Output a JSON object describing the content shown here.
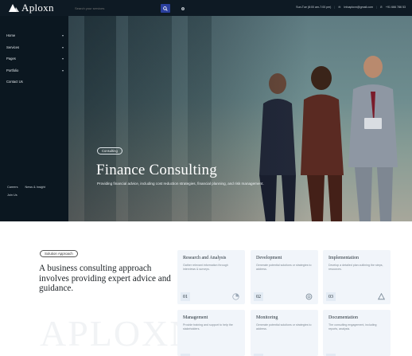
{
  "brand": {
    "name": "Aploxn"
  },
  "search": {
    "placeholder": "Search your services"
  },
  "contact": {
    "hours": "Sun-Tue (8:00 am-7:00 pm)",
    "email": "Infoaploxn@gmail.com",
    "phone": "+91 666 786 53"
  },
  "sidebar": {
    "items": [
      {
        "label": "Home",
        "has_children": true
      },
      {
        "label": "Services",
        "has_children": true
      },
      {
        "label": "Pages",
        "has_children": true
      },
      {
        "label": "Portfolio",
        "has_children": true
      },
      {
        "label": "Contact Us",
        "has_children": false
      }
    ],
    "bottom_links": [
      "Careers",
      "News & Insight",
      "Join Us"
    ]
  },
  "hero": {
    "tag": "Consulting",
    "title": "Finance Consulting",
    "description": "Providing financial advice, including cost reduction strategies, financial planning, and risk management."
  },
  "solution": {
    "tag": "Solution Approach",
    "lead": "A business consulting approach involves providing expert advice and guidance.",
    "watermark": "APLOXN"
  },
  "cards": [
    {
      "title": "Research and Analysis",
      "desc": "Gather relevant information through interviews & surveys.",
      "num": "01",
      "icon": "pie-chart-icon"
    },
    {
      "title": "Development",
      "desc": "Generate potential solutions or strategies to address.",
      "num": "02",
      "icon": "refresh-icon"
    },
    {
      "title": "Implementation",
      "desc": "Develop a detailed plan outlining the steps, resources.",
      "num": "03",
      "icon": "recycle-icon"
    },
    {
      "title": "Management",
      "desc": "Provide training and support to help the stakeholders.",
      "num": "",
      "icon": ""
    },
    {
      "title": "Monitoring",
      "desc": "Generate potential solutions or strategies to address.",
      "num": "",
      "icon": ""
    },
    {
      "title": "Documentation",
      "desc": "The consulting engagement, including reports, analysis.",
      "num": "",
      "icon": ""
    }
  ],
  "colors": {
    "topbar": "#0e1a24",
    "sidebar": "#0b1720",
    "accent": "#2a3f9e",
    "card": "#f1f5fa"
  }
}
